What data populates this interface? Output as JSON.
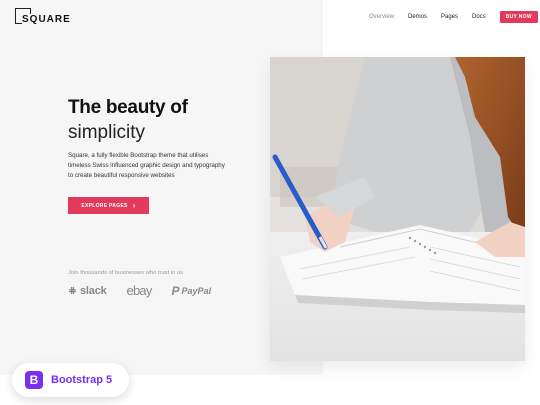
{
  "logo": {
    "text": "SQUARE"
  },
  "nav": {
    "items": [
      {
        "label": "Overview",
        "active": false
      },
      {
        "label": "Demos",
        "active": true
      },
      {
        "label": "Pages",
        "active": true
      },
      {
        "label": "Docs",
        "active": true
      }
    ],
    "buy_label": "BUY NOW"
  },
  "hero": {
    "title": "The beauty of",
    "subtitle": "simplicity",
    "description": "Square, a fully flexible Bootstrap theme that utilises timeless Swiss influenced graphic design and typography to create beautiful responsive websites",
    "cta_label": "EXPLORE PAGES",
    "cta_icon": "chevron-right-icon"
  },
  "trust": {
    "text": "Join thousands of businesses who trust in us",
    "brands": [
      "slack",
      "ebay",
      "PayPal"
    ]
  },
  "badge": {
    "icon_letter": "B",
    "label": "Bootstrap 5"
  },
  "colors": {
    "accent": "#e23a5c",
    "bootstrap_purple": "#7a2ff0",
    "hero_bg": "#f6f6f6"
  }
}
